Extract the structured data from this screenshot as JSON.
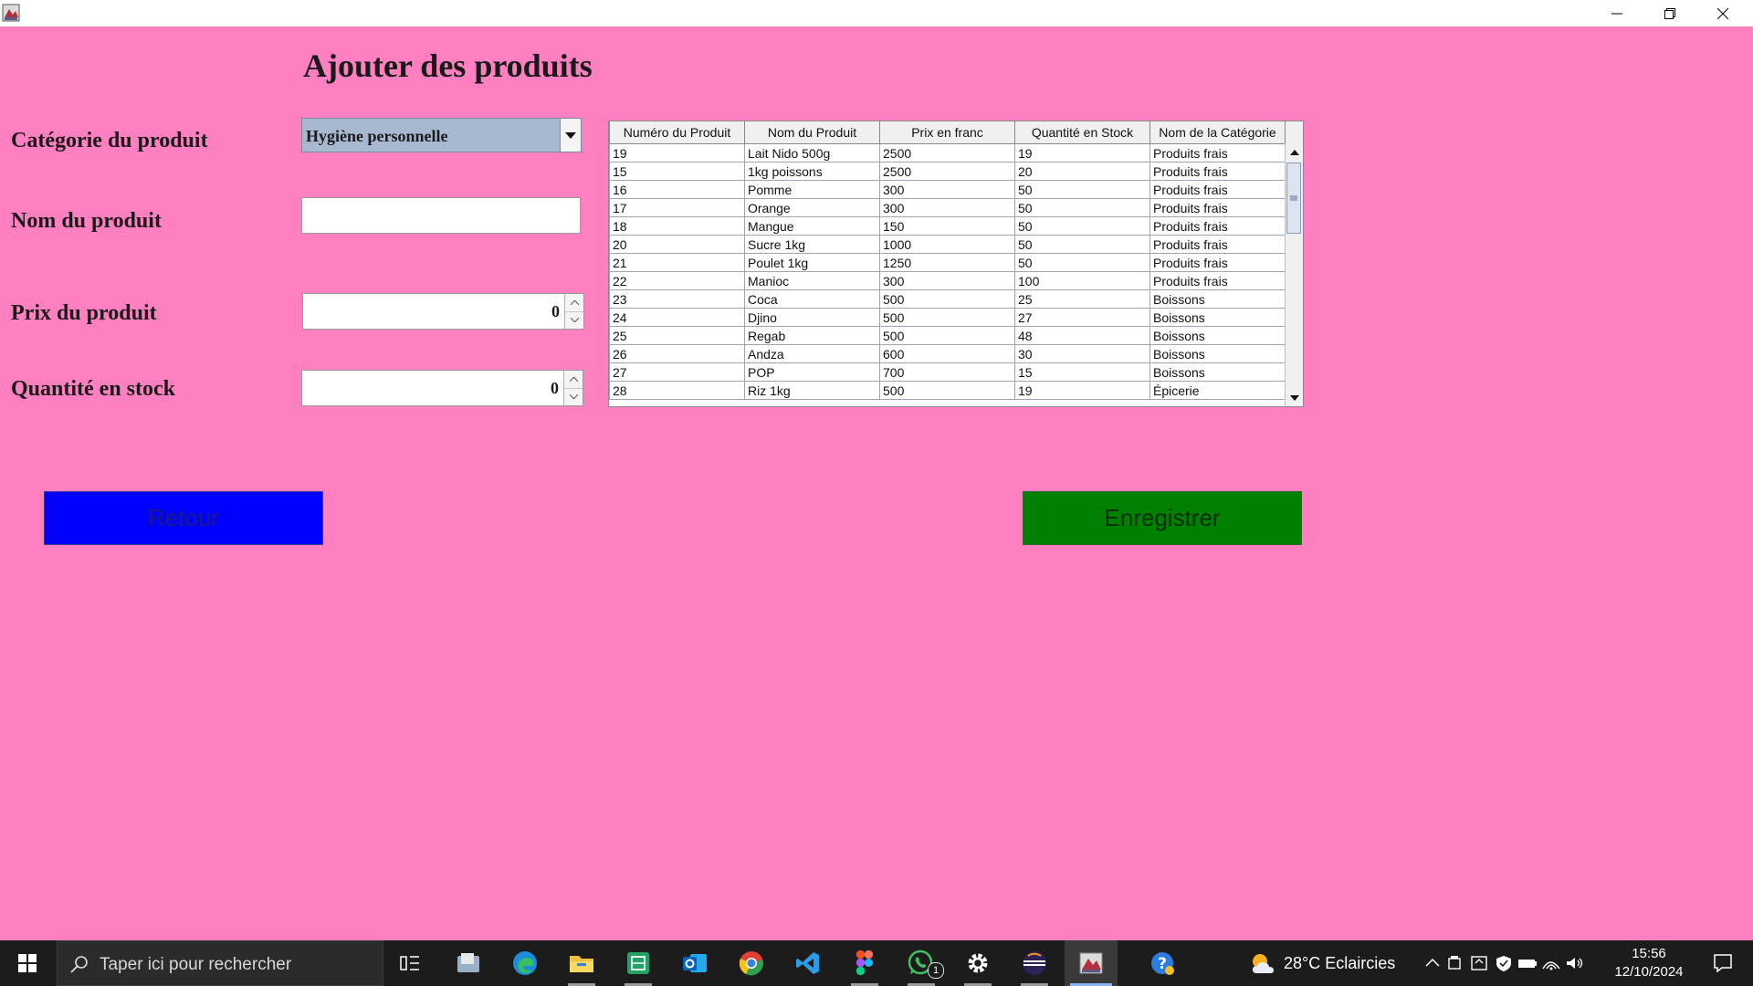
{
  "window": {
    "minimize_icon": "minimize-icon",
    "restore_icon": "restore-icon",
    "close_icon": "close-icon"
  },
  "form": {
    "title": "Ajouter des produits",
    "category_label": "Catégorie du produit",
    "category_value": "Hygiène personnelle",
    "name_label": "Nom du produit",
    "name_value": "",
    "price_label": "Prix du produit",
    "price_value": "0",
    "quantity_label": "Quantité en stock",
    "quantity_value": "0"
  },
  "table": {
    "columns": [
      "Numéro du Produit",
      "Nom du Produit",
      "Prix en franc",
      "Quantité en Stock",
      "Nom de la Catégorie"
    ],
    "rows": [
      [
        "19",
        "Lait Nido 500g",
        "2500",
        "19",
        "Produits frais"
      ],
      [
        "15",
        "1kg poissons",
        "2500",
        "20",
        "Produits frais"
      ],
      [
        "16",
        "Pomme",
        "300",
        "50",
        "Produits frais"
      ],
      [
        "17",
        "Orange",
        "300",
        "50",
        "Produits frais"
      ],
      [
        "18",
        "Mangue",
        "150",
        "50",
        "Produits frais"
      ],
      [
        "20",
        "Sucre 1kg",
        "1000",
        "50",
        "Produits frais"
      ],
      [
        "21",
        "Poulet 1kg",
        "1250",
        "50",
        "Produits frais"
      ],
      [
        "22",
        "Manioc",
        "300",
        "100",
        "Produits frais"
      ],
      [
        "23",
        "Coca",
        "500",
        "25",
        "Boissons"
      ],
      [
        "24",
        "Djino",
        "500",
        "27",
        "Boissons"
      ],
      [
        "25",
        "Regab",
        "500",
        "48",
        "Boissons"
      ],
      [
        "26",
        "Andza",
        "600",
        "30",
        "Boissons"
      ],
      [
        "27",
        "POP",
        "700",
        "15",
        "Boissons"
      ],
      [
        "28",
        "Riz 1kg",
        "500",
        "19",
        "Épicerie"
      ]
    ]
  },
  "buttons": {
    "back_label": "Retour",
    "save_label": "Enregistrer"
  },
  "taskbar": {
    "search_placeholder": "Taper ici pour rechercher",
    "whatsapp_badge": "1",
    "weather_text": "28°C  Eclaircies",
    "time": "15:56",
    "date": "12/10/2024"
  },
  "colors": {
    "background": "#ff80c0",
    "back_button": "#0000ff",
    "save_button": "#008000",
    "combo": "#a8b8d0"
  }
}
